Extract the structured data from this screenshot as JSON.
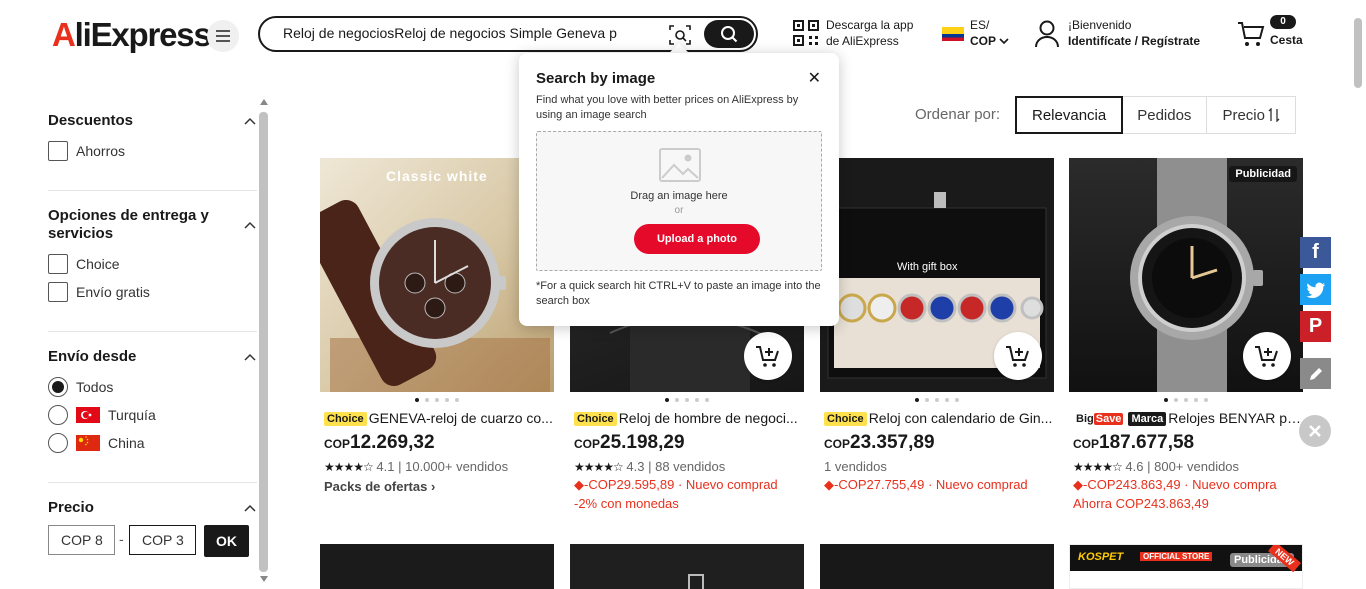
{
  "header": {
    "logo": "AliExpress",
    "search_value": "Reloj de negociosReloj de negocios Simple Geneva p",
    "app_line1": "Descarga la app",
    "app_line2": "de AliExpress",
    "lang": "ES/",
    "currency": "COP",
    "welcome": "¡Bienvenido",
    "signin": "Identifícate / Regístrate",
    "cart_count": "0",
    "cart_label": "Cesta"
  },
  "popup": {
    "title": "Search by image",
    "desc": "Find what you love with better prices on AliExpress by using an image search",
    "drag": "Drag an image here",
    "or": "or",
    "upload": "Upload a photo",
    "tip": "*For a quick search hit CTRL+V to paste an image into the search box"
  },
  "sidebar": {
    "descuentos": "Descuentos",
    "ahorros": "Ahorros",
    "entrega": "Opciones de entrega y servicios",
    "choice": "Choice",
    "envio_gratis": "Envío gratis",
    "envio_desde": "Envío desde",
    "todos": "Todos",
    "turquia": "Turquía",
    "china": "China",
    "precio": "Precio",
    "min_value": "COP 8",
    "max_value": "COP 3",
    "ok": "OK"
  },
  "sort": {
    "label": "Ordenar por:",
    "tabs": [
      "Relevancia",
      "Pedidos",
      "Precio"
    ]
  },
  "products": [
    {
      "img_text": "Classic white",
      "badge": "Choice",
      "title": "GENEVA-reloj de cuarzo co...",
      "currency": "COP",
      "price": "12.269,32",
      "rating": "4.1",
      "sold": "10.000+ vendidos",
      "bundle": "Packs de ofertas"
    },
    {
      "badge": "Choice",
      "title": "Reloj de hombre de negoci...",
      "currency": "COP",
      "price": "25.198,29",
      "rating": "4.3",
      "sold": "88 vendidos",
      "discount": "-COP29.595,89 · Nuevo comprad",
      "extra": "-2% con monedas"
    },
    {
      "img_text": "With gift box",
      "badge": "Choice",
      "title": "Reloj con calendario de Gin...",
      "currency": "COP",
      "price": "23.357,89",
      "sold": "1 vendidos",
      "discount": "-COP27.755,49 · Nuevo comprad"
    },
    {
      "ad": "Publicidad",
      "badge_big": "Big",
      "badge_save": "Save",
      "badge_marca": "Marca",
      "title": "Relojes BENYAR par...",
      "currency": "COP",
      "price": "187.677,58",
      "rating": "4.6",
      "sold": "800+ vendidos",
      "discount": "-COP243.863,49 · Nuevo compra",
      "extra": "Ahorra COP243.863,49"
    }
  ],
  "row2": {
    "brand": "KOSPET",
    "store": "OFFICIAL STORE",
    "new": "NEW",
    "ad": "Publicidad"
  },
  "social": {
    "facebook": "f",
    "pinterest": "P"
  },
  "colors": {
    "accent": "#e8301c",
    "upload_btn": "#e50a2a",
    "choice_badge": "#ffe14d"
  }
}
